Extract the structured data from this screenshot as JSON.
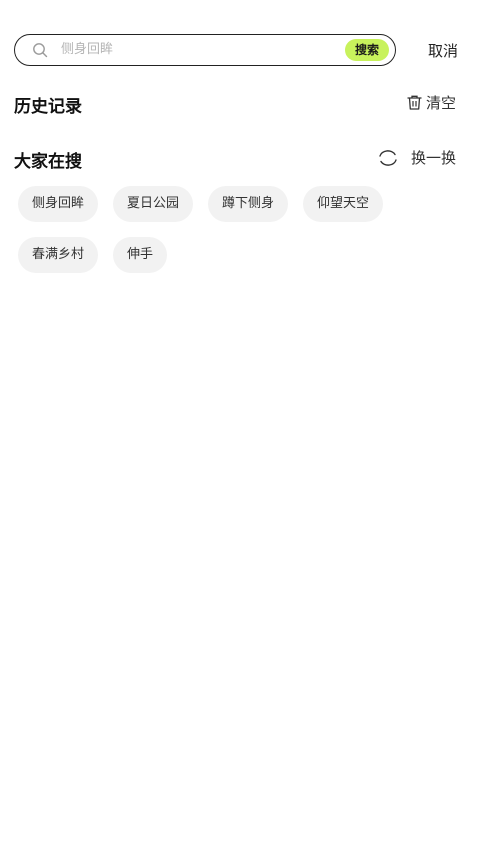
{
  "search": {
    "placeholder": "侧身回眸",
    "button_label": "搜索",
    "cancel_label": "取消"
  },
  "history": {
    "title": "历史记录",
    "clear_label": "清空",
    "clear_icon": "trash-icon"
  },
  "hot": {
    "title": "大家在搜",
    "refresh_label": "换一换",
    "refresh_icon": "refresh-icon",
    "tags": [
      "侧身回眸",
      "夏日公园",
      "蹲下侧身",
      "仰望天空",
      "春满乡村",
      "伸手"
    ]
  },
  "colors": {
    "accent": "#c8f25c",
    "tag_bg": "#f2f2f2"
  }
}
